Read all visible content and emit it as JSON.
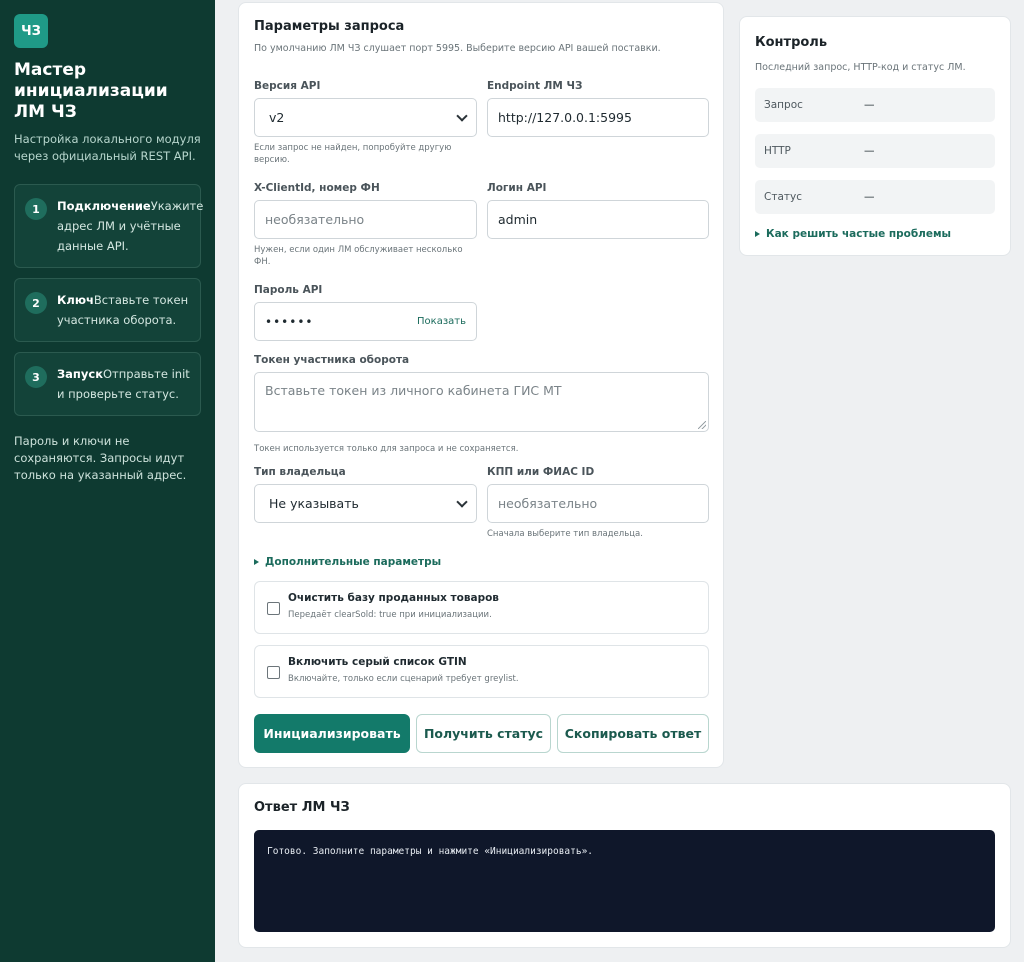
{
  "sidebar": {
    "logo": "ЧЗ",
    "title": "Мастер инициализации ЛМ ЧЗ",
    "subtitle": "Настройка локального модуля через официальный REST API.",
    "steps": [
      {
        "num": "1",
        "title": "Подключение",
        "text": "Укажите адрес ЛМ и учётные данные API."
      },
      {
        "num": "2",
        "title": "Ключ",
        "text": "Вставьте токен участника оборота."
      },
      {
        "num": "3",
        "title": "Запуск",
        "text": "Отправьте init и проверьте статус."
      }
    ],
    "footer": "Пароль и ключи не сохраняются. Запросы идут только на указанный адрес."
  },
  "params": {
    "title": "Параметры запроса",
    "subtitle": "По умолчанию ЛМ ЧЗ слушает порт 5995. Выберите версию API вашей поставки.",
    "api_version": {
      "label": "Версия API",
      "value": "v2",
      "hint": "Если запрос не найден, попробуйте другую версию."
    },
    "endpoint": {
      "label": "Endpoint ЛМ ЧЗ",
      "value": "http://127.0.0.1:5995"
    },
    "client_id": {
      "label": "X-ClientId, номер ФН",
      "placeholder": "необязательно",
      "hint": "Нужен, если один ЛМ обслуживает несколько ФН."
    },
    "login": {
      "label": "Логин API",
      "value": "admin"
    },
    "password": {
      "label": "Пароль API",
      "value": "••••••",
      "show": "Показать"
    },
    "token": {
      "label": "Токен участника оборота",
      "placeholder": "Вставьте токен из личного кабинета ГИС МТ",
      "hint": "Токен используется только для запроса и не сохраняется."
    },
    "owner_type": {
      "label": "Тип владельца",
      "value": "Не указывать"
    },
    "kpp": {
      "label": "КПП или ФИАС ID",
      "placeholder": "необязательно",
      "hint": "Сначала выберите тип владельца."
    },
    "advanced": "Дополнительные параметры",
    "clear_sold": {
      "title": "Очистить базу проданных товаров",
      "sub": "Передаёт clearSold: true при инициализации."
    },
    "greylist": {
      "title": "Включить серый список GTIN",
      "sub": "Включайте, только если сценарий требует greylist."
    },
    "buttons": {
      "init": "Инициализировать",
      "status": "Получить статус",
      "copy": "Скопировать ответ"
    }
  },
  "control": {
    "title": "Контроль",
    "subtitle": "Последний запрос, HTTP-код и статус ЛМ.",
    "rows": [
      {
        "key": "Запрос",
        "value": "—"
      },
      {
        "key": "HTTP",
        "value": "—"
      },
      {
        "key": "Статус",
        "value": "—"
      }
    ],
    "help": "Как решить частые проблемы"
  },
  "response": {
    "title": "Ответ ЛМ ЧЗ",
    "text": "Готово. Заполните параметры и нажмите «Инициализировать»."
  }
}
